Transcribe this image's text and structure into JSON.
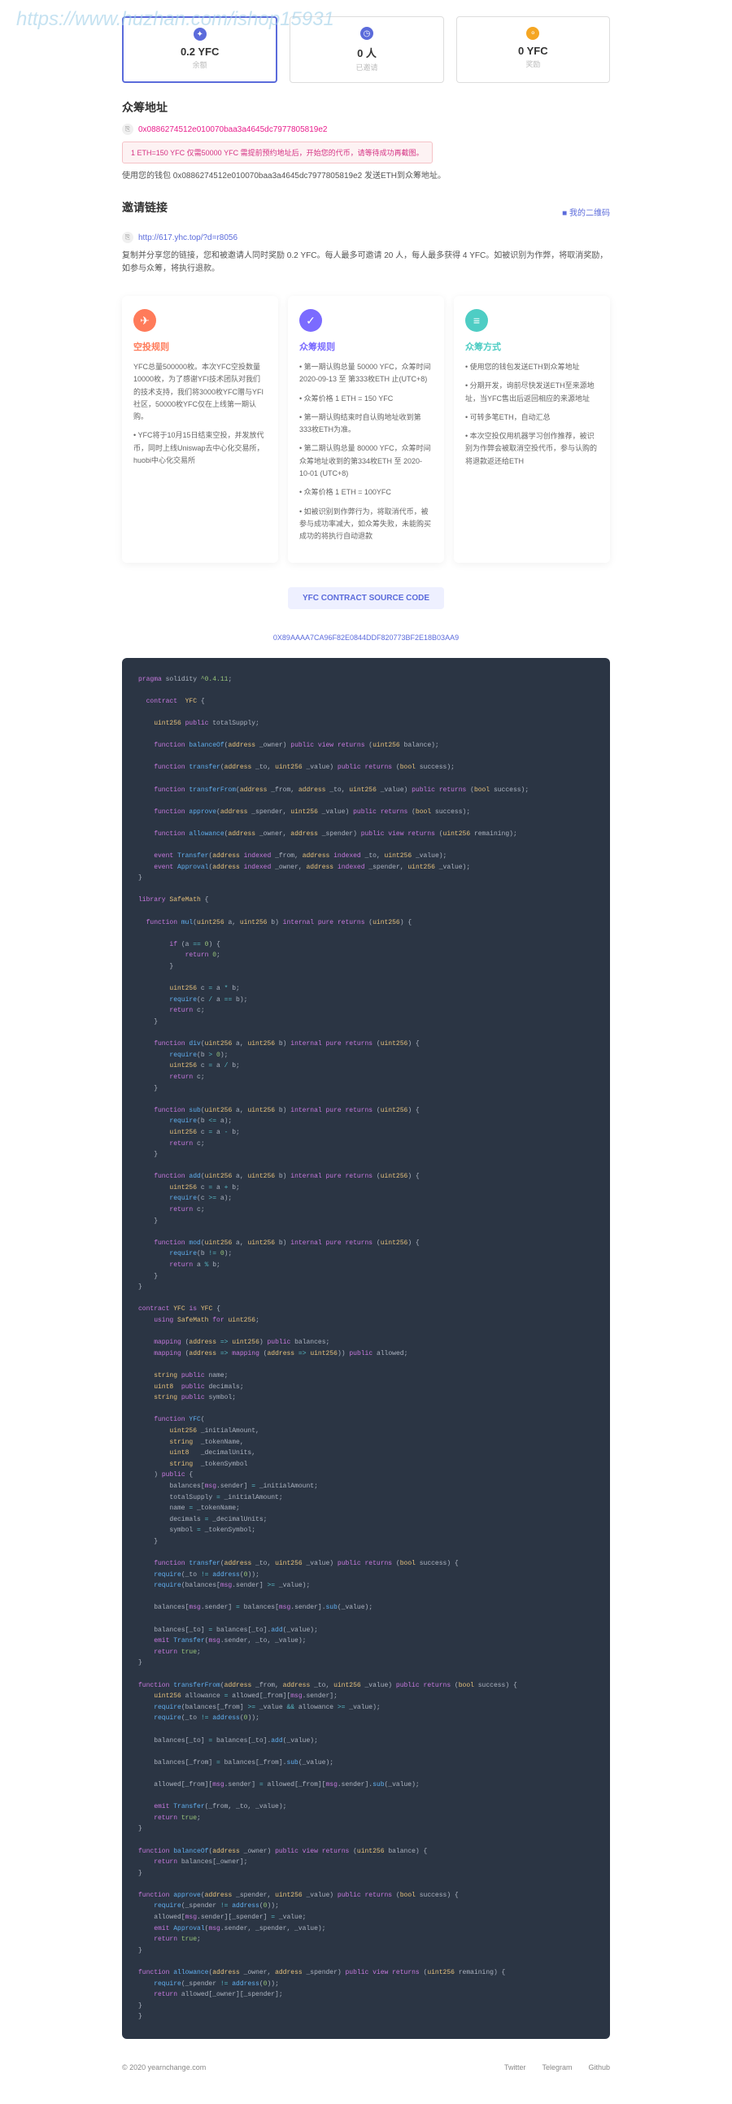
{
  "watermark": "https://www.huzhan.com/ishop15931",
  "stats": [
    {
      "icon_bg": "#5b6bdb",
      "icon": "✦",
      "value": "0.2 YFC",
      "label": "余额"
    },
    {
      "icon_bg": "#5b6bdb",
      "icon": "◷",
      "value": "0 人",
      "label": "已邀请"
    },
    {
      "icon_bg": "#f5a623",
      "icon": "⚬",
      "value": "0 YFC",
      "label": "奖励"
    }
  ],
  "addr": {
    "title": "众筹地址",
    "link": "0x0886274512e010070baa3a4645dc7977805819e2",
    "notice": "1 ETH=150 YFC 仅需50000 YFC 需提前预约地址后，开始您的代币，请等待成功再截图。",
    "desc": "使用您的钱包 0x0886274512e010070baa3a4645dc7977805819e2 发送ETH到众筹地址。"
  },
  "invite": {
    "title": "邀请链接",
    "qr": "■ 我的二维码",
    "link": "http://617.yhc.top/?d=r8056",
    "desc": "复制并分享您的链接，您和被邀请人同时奖励 0.2 YFC。每人最多可邀请 20 人，每人最多获得 4 YFC。如被识别为作弊，将取消奖励，如参与众筹，将执行退款。"
  },
  "cards": [
    {
      "icon_bg": "#ff7b5a",
      "icon": "✈",
      "title_color": "#ff7b5a",
      "title": "空投规则",
      "body": [
        "YFC总量500000枚。本次YFC空投数量10000枚，为了感谢YFI技术团队对我们的技术支持，我们将3000枚YFC赠与YFI社区，50000枚YFC仅在上线第一期认购。",
        "• YFC将于10月15日结束空投，并发放代币，同时上线Uniswap去中心化交易所，huobi中心化交易所"
      ]
    },
    {
      "icon_bg": "#7b6bff",
      "icon": "✓",
      "title_color": "#7b6bff",
      "title": "众筹规则",
      "body": [
        "• 第一期认购总量 50000 YFC，众筹时间 2020-09-13 至 第333枚ETH 止(UTC+8)",
        "• 众筹价格 1 ETH = 150 YFC",
        "• 第一期认购结束时自认购地址收到第333枚ETH为准。",
        "• 第二期认购总量 80000 YFC，众筹时间 众筹地址收到的第334枚ETH 至 2020-10-01 (UTC+8)",
        "• 众筹价格 1 ETH = 100YFC",
        "• 如被识别到作弊行为，将取消代币，被参与成功率减大，如众筹失败，未能购买成功的将执行自动退款"
      ]
    },
    {
      "icon_bg": "#4ecdc4",
      "icon": "≡",
      "title_color": "#4ecdc4",
      "title": "众筹方式",
      "body": [
        "• 使用您的钱包发送ETH到众筹地址",
        "• 分期开发，询前尽快发送ETH至来源地址，当YFC售出后返回相应的来源地址",
        "• 可转多笔ETH，自动汇总",
        "• 本次空投仅用机器学习创作推荐，被识别为作弊会被取消空投代币，参与认购的将退款返还给ETH"
      ]
    }
  ],
  "src_btn": "YFC CONTRACT SOURCE CODE",
  "hash": "0X89AAAA7CA96F82E0844DDF820773BF2E18B03AA9",
  "footer": {
    "copy": "© 2020 yearnchange.com",
    "links": [
      "Twitter",
      "Telegram",
      "Github"
    ]
  }
}
